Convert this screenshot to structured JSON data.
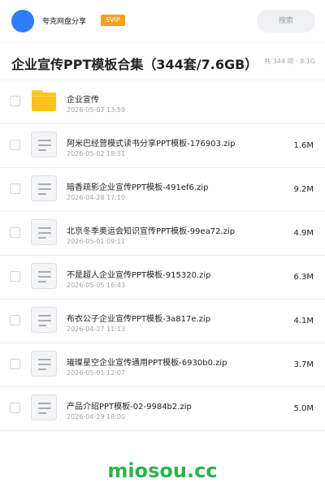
{
  "header": {
    "app_name": "夸克网盘分享",
    "vip_label": "SVIP",
    "search_label": "搜索"
  },
  "title_bar": {
    "title": "企业宣传PPT模板合集（344套/7.6GB）",
    "summary": "共 344 项 · 8.1G"
  },
  "files": [
    {
      "icon": "folder-icon",
      "name": "企业宣传",
      "date": "2026-05-07 13:59",
      "size": ""
    },
    {
      "icon": "file-icon",
      "name": "阿米巴经营模式读书分享PPT模板-176903.zip",
      "date": "2026-05-02 18:51",
      "size": "1.6M"
    },
    {
      "icon": "file-icon",
      "name": "暗香疏影企业宣传PPT模板-491ef6.zip",
      "date": "2026-04-28 17:10",
      "size": "9.2M"
    },
    {
      "icon": "file-icon",
      "name": "北京冬季奥运会知识宣传PPT模板-99ea72.zip",
      "date": "2026-05-01 09:11",
      "size": "4.9M"
    },
    {
      "icon": "file-icon",
      "name": "不是超人企业宣传PPT模板-915320.zip",
      "date": "2026-05-05 16:43",
      "size": "6.3M"
    },
    {
      "icon": "file-icon",
      "name": "布衣公子企业宣传PPT模板-3a817e.zip",
      "date": "2026-04-27 11:13",
      "size": "4.1M"
    },
    {
      "icon": "file-icon",
      "name": "璀璨星空企业宣传通用PPT模板-6930b0.zip",
      "date": "2026-05-01 12:07",
      "size": "3.7M"
    },
    {
      "icon": "file-icon",
      "name": "产品介绍PPT模板-02-9984b2.zip",
      "date": "2026-04-29 18:00",
      "size": "5.0M"
    }
  ],
  "watermark": "miosou.cc",
  "colors": {
    "accent": "#2e7cf6",
    "vip": "#f5a01e",
    "watermark": "#2db34a",
    "folder": "#ffc21a"
  }
}
